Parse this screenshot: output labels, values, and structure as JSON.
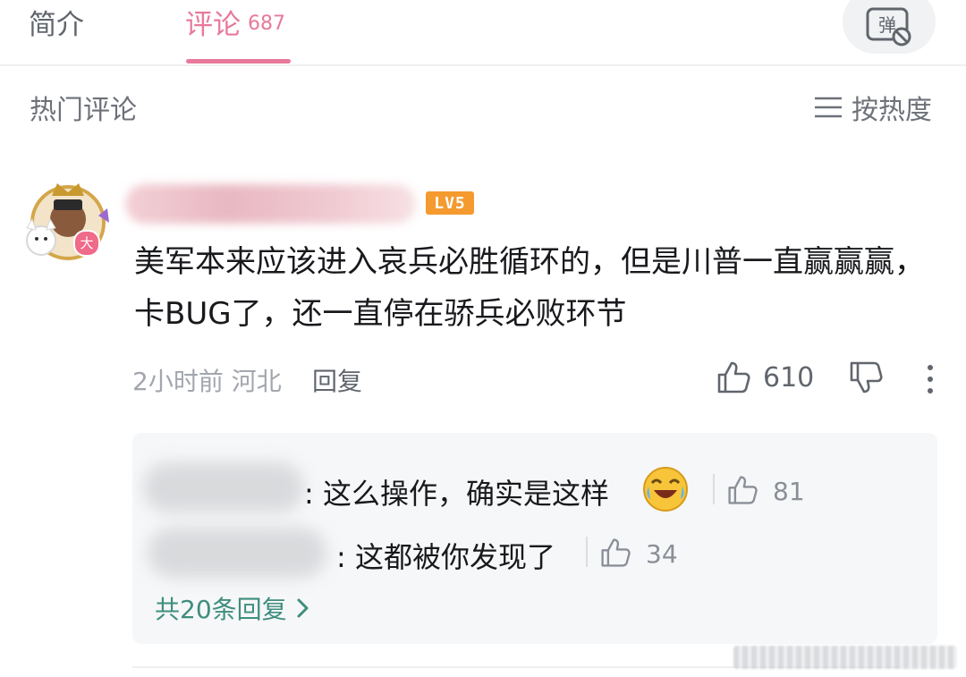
{
  "tabs": {
    "intro": "简介",
    "comments": "评论",
    "comments_count": "687",
    "danmaku_icon": "danmaku-off-icon"
  },
  "section": {
    "title": "热门评论",
    "sort_label": "按热度",
    "sort_icon": "menu-lines-icon"
  },
  "comment": {
    "level": "LV5",
    "avatar_badge": "大",
    "text": "美军本来应该进入哀兵必胜循环的，但是川普一直赢赢赢，卡BUG了，还一直停在骄兵必败环节",
    "time": "2小时前",
    "location": "河北",
    "reply_label": "回复",
    "likes": "610"
  },
  "replies": {
    "items": [
      {
        "text": ": 这么操作，确实是这样",
        "likes": "81",
        "emoji": "laugh-cry-emoji"
      },
      {
        "text": ": 这都被你发现了",
        "likes": "34"
      }
    ],
    "more_label": "共20条回复"
  },
  "colors": {
    "accent": "#e8799b",
    "level_badge": "#f49a2e",
    "link_green": "#3e8e7e"
  }
}
